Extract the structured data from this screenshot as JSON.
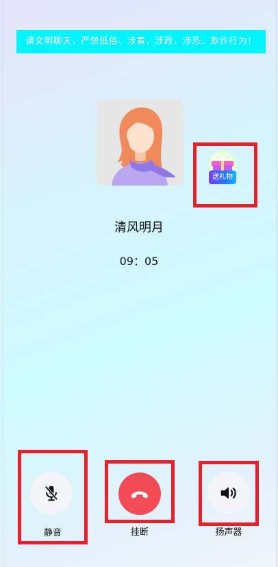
{
  "notice": "请文明聊天，严禁低俗、涉黄、涉政、涉恐、欺诈行为！",
  "caller": {
    "name": "清风明月",
    "duration": "09：05",
    "avatar_icon": "woman-avatar-icon"
  },
  "gift": {
    "label": "送礼物",
    "icon": "gift-icon"
  },
  "controls": {
    "mute": {
      "label": "静音",
      "icon": "mic-off-icon"
    },
    "hangup": {
      "label": "挂断",
      "icon": "phone-hangup-icon",
      "color": "#f24b55"
    },
    "speaker": {
      "label": "扬声器",
      "icon": "speaker-icon"
    }
  },
  "colors": {
    "notice_bg": "#00f5ff",
    "highlight_border": "#e8202b",
    "control_bg": "#f3f5f9"
  }
}
